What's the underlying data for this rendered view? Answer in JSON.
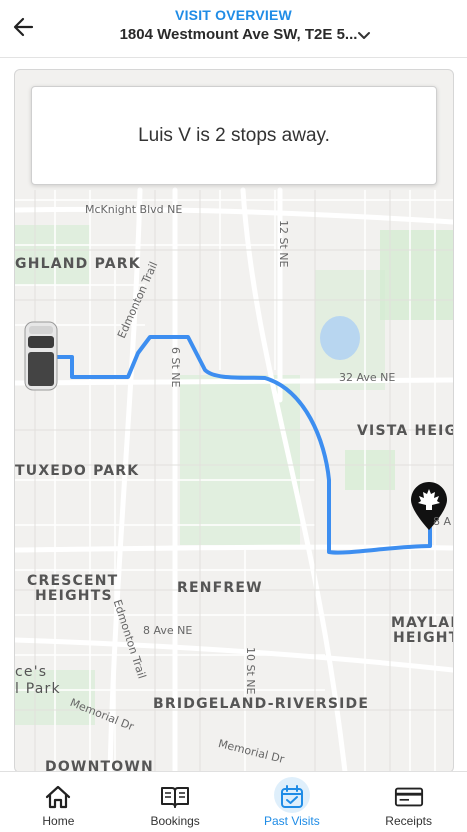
{
  "header": {
    "kicker": "VISIT OVERVIEW",
    "address": "1804 Westmount Ave SW, T2E 5..."
  },
  "status": {
    "message": "Luis V is 2 stops away."
  },
  "map": {
    "route_color": "#3d8ef0",
    "labels": {
      "mcknight": "McKnight Blvd NE",
      "highland": "GHLAND PARK",
      "twelve_st": "12 St NE",
      "edmonton_trail": "Edmonton Trail",
      "six_st": "6 St NE",
      "thirty_two": "32 Ave NE",
      "vista": "VISTA HEIG",
      "tuxedo": "TUXEDO PARK",
      "eight_a": "8 A",
      "crescent": "CRESCENT",
      "heights": "HEIGHTS",
      "renfrew": "RENFREW",
      "edmonton_trail2": "Edmonton Trail",
      "eight_ave": "8 Ave NE",
      "ten_st": "10 St NE",
      "mayland": "MAYLAN",
      "heights2": "HEIGHT",
      "ces": "ce's",
      "park": "l Park",
      "bridgeland": "BRIDGELAND-RIVERSIDE",
      "memorial1": "Memorial Dr",
      "memorial2": "Memorial Dr",
      "downtown": "DOWNTOWN"
    }
  },
  "nav": {
    "items": [
      {
        "label": "Home",
        "icon": "home-icon"
      },
      {
        "label": "Bookings",
        "icon": "book-icon"
      },
      {
        "label": "Past Visits",
        "icon": "calendar-check-icon",
        "active": true
      },
      {
        "label": "Receipts",
        "icon": "receipt-icon"
      }
    ],
    "active_color": "#1f8ce6"
  }
}
